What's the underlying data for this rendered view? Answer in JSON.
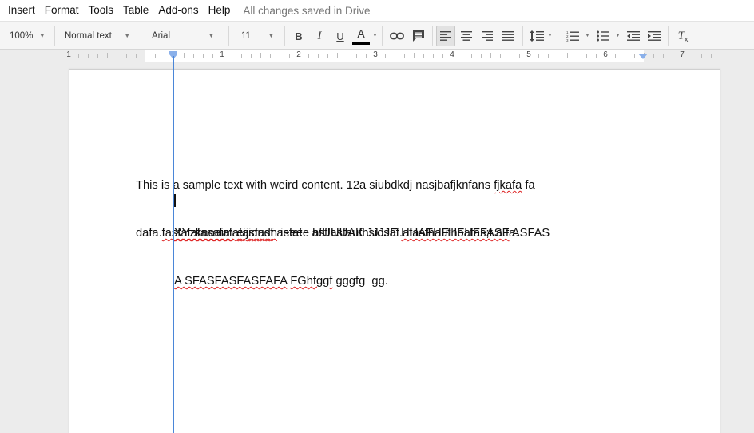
{
  "menu": {
    "items": [
      "Insert",
      "Format",
      "Tools",
      "Table",
      "Add-ons",
      "Help"
    ],
    "status": "All changes saved in Drive"
  },
  "toolbar": {
    "zoom": "100%",
    "style": "Normal text",
    "font": "Arial",
    "font_size": "11",
    "bold": "B",
    "italic": "I",
    "underline": "U",
    "text_color": "A",
    "clear_format": "T"
  },
  "ruler": {
    "numbers": [
      "1",
      "1",
      "2",
      "3",
      "4",
      "5",
      "6",
      "7"
    ]
  },
  "document": {
    "para1_line1": [
      "This is a sample text with weird content. 12a siubdkdj nasjbafjknfans ",
      "fjkafa",
      " fa"
    ],
    "para1_line2": [
      "dafa.",
      "fasfafafasafafafasfasf",
      " asfaf . asflasfaufhsiosaf.afasfhaufhoafas;f.a.fa."
    ],
    "para2_line1": [
      "",
      "XYzknoaim",
      " ",
      "eijidudn",
      " ieeee hfUUUAK JJJJE ",
      "HHAFHFHFHFFASF",
      " ASFAS"
    ],
    "para2_line2": [
      "A SFASFASFASFAFA",
      " ",
      "FGhfggf",
      " gggfg  gg."
    ]
  },
  "colors": {
    "accent": "#4a86d8",
    "spellcheck": "#dd2222"
  }
}
